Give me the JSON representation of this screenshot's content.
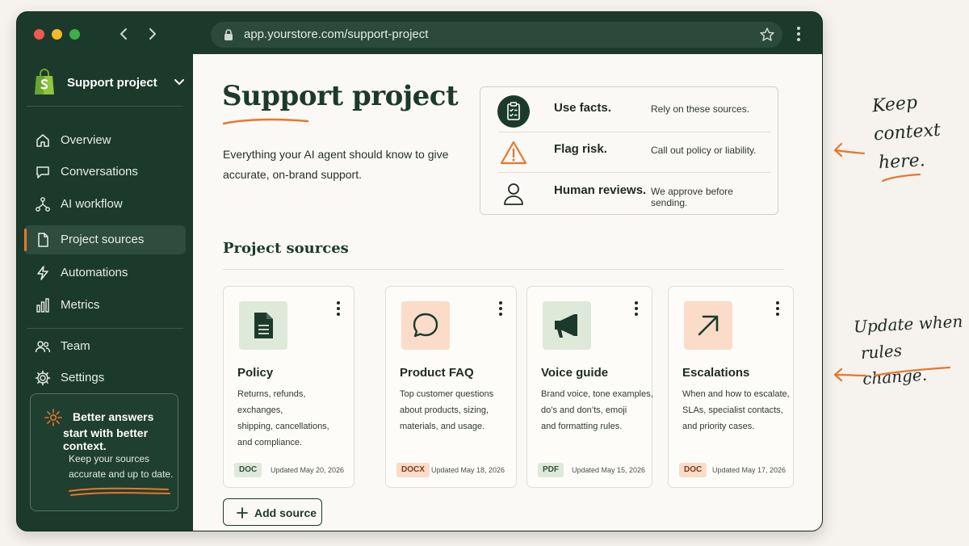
{
  "browser": {
    "url": "app.yourstore.com/support-project"
  },
  "sidebar": {
    "store_name": "Support project",
    "items": [
      {
        "label": "Overview",
        "icon": "home-icon"
      },
      {
        "label": "Conversations",
        "icon": "chat-icon"
      },
      {
        "label": "AI workflow",
        "icon": "workflow-icon"
      },
      {
        "label": "Project sources",
        "icon": "document-icon",
        "active": true
      },
      {
        "label": "Automations",
        "icon": "lightning-icon"
      },
      {
        "label": "Metrics",
        "icon": "bar-chart-icon"
      },
      {
        "label": "Team",
        "icon": "team-icon"
      },
      {
        "label": "Settings",
        "icon": "gear-icon"
      }
    ],
    "tip": {
      "line1": "Better answers",
      "line2": "start with better context.",
      "line3": "Keep your sources",
      "line4": "accurate and up to date."
    }
  },
  "main": {
    "title": "Support project",
    "description": "Everything your AI agent should know to give accurate, on-brand support.",
    "rules": [
      {
        "title": "Use facts.",
        "detail": "Rely on these sources.",
        "icon": "clipboard-check-icon"
      },
      {
        "title": "Flag risk.",
        "detail": "Call out policy or liability.",
        "icon": "warning-icon"
      },
      {
        "title": "Human reviews.",
        "detail": "We approve before sending.",
        "icon": "person-icon"
      }
    ],
    "section_title": "Project sources",
    "sources": [
      {
        "name": "Policy",
        "desc": [
          "Returns, refunds, exchanges,",
          "shipping, cancellations,",
          "and compliance."
        ],
        "badge": "DOC",
        "updated": "Updated May 20, 2026",
        "icon": "document-icon"
      },
      {
        "name": "Product FAQ",
        "desc": [
          "Top customer questions",
          "about products, sizing,",
          "materials, and usage."
        ],
        "badge": "DOCX",
        "updated": "Updated May 18, 2026",
        "icon": "chat-bubble-icon"
      },
      {
        "name": "Voice guide",
        "desc": [
          "Brand voice, tone examples,",
          "do’s and don’ts, emoji",
          "and formatting rules."
        ],
        "badge": "PDF",
        "updated": "Updated May 15, 2026",
        "icon": "megaphone-icon"
      },
      {
        "name": "Escalations",
        "desc": [
          "When and how to escalate,",
          "SLAs, specialist contacts,",
          "and priority cases."
        ],
        "badge": "DOC",
        "updated": "Updated May 17, 2026",
        "icon": "arrow-up-right-icon"
      }
    ],
    "add_source_label": "Add source"
  },
  "annotations": {
    "note1": [
      "Keep",
      "context",
      "here."
    ],
    "note2": [
      "Update when",
      "rules change."
    ]
  },
  "colors": {
    "sidebar_bg": "#1c3a2c",
    "accent_orange": "#e8762d",
    "tile_green": "#dfe9da",
    "tile_peach": "#fbdcc8"
  }
}
